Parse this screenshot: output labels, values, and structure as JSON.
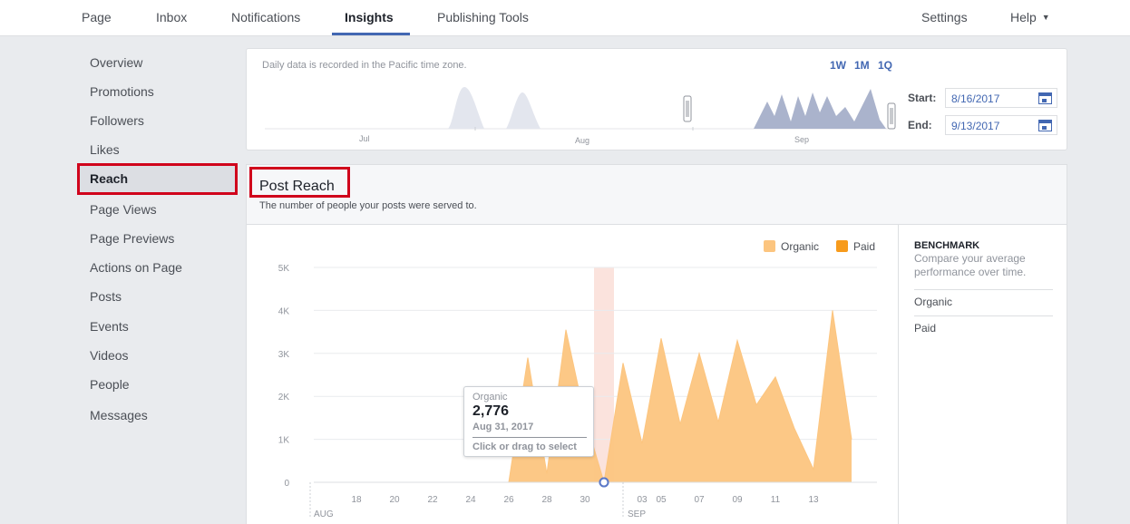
{
  "nav": {
    "items": [
      "Page",
      "Inbox",
      "Notifications",
      "Insights",
      "Publishing Tools"
    ],
    "active": "Insights",
    "right_items": [
      "Settings",
      "Help"
    ]
  },
  "sidebar": {
    "items": [
      "Overview",
      "Promotions",
      "Followers",
      "Likes",
      "Reach",
      "Page Views",
      "Page Previews",
      "Actions on Page",
      "Posts",
      "Events",
      "Videos",
      "People",
      "Messages"
    ],
    "active": "Reach"
  },
  "date_panel": {
    "timezone_note": "Daily data is recorded in the Pacific time zone.",
    "range_buttons": [
      "1W",
      "1M",
      "1Q"
    ],
    "timeline_months": [
      "Jul",
      "Aug",
      "Sep"
    ],
    "start_label": "Start:",
    "start_value": "8/16/2017",
    "end_label": "End:",
    "end_value": "9/13/2017"
  },
  "post_reach": {
    "title": "Post Reach",
    "subtitle": "The number of people your posts were served to."
  },
  "benchmark": {
    "title": "BENCHMARK",
    "description": "Compare your average performance over time.",
    "rows": [
      "Organic",
      "Paid"
    ]
  },
  "tooltip": {
    "series": "Organic",
    "value": "2,776",
    "date": "Aug 31, 2017",
    "action": "Click or drag to select"
  },
  "colors": {
    "organic": "#fcc57f",
    "paid": "#f79b1c",
    "accent": "#4267b2",
    "highlight": "#d0021b",
    "selection": "#f9d7cf"
  },
  "chart_data": {
    "type": "area",
    "x": [
      "2017-08-16",
      "2017-08-17",
      "2017-08-18",
      "2017-08-19",
      "2017-08-20",
      "2017-08-21",
      "2017-08-22",
      "2017-08-23",
      "2017-08-24",
      "2017-08-25",
      "2017-08-26",
      "2017-08-27",
      "2017-08-28",
      "2017-08-29",
      "2017-08-30",
      "2017-08-31",
      "2017-09-01",
      "2017-09-02",
      "2017-09-03",
      "2017-09-04",
      "2017-09-05",
      "2017-09-06",
      "2017-09-07",
      "2017-09-08",
      "2017-09-09",
      "2017-09-10",
      "2017-09-11",
      "2017-09-12",
      "2017-09-13"
    ],
    "x_tick_labels": [
      "18",
      "20",
      "22",
      "24",
      "26",
      "28",
      "30",
      "03",
      "05",
      "07",
      "09",
      "11",
      "13"
    ],
    "month_labels": [
      "AUG",
      "SEP"
    ],
    "series": [
      {
        "name": "Organic",
        "values": [
          0,
          0,
          0,
          0,
          0,
          0,
          0,
          0,
          0,
          0,
          0,
          2900,
          200,
          3550,
          1500,
          0,
          2776,
          900,
          3350,
          1350,
          3000,
          1400,
          3300,
          1800,
          2450,
          1250,
          300,
          4000,
          1000
        ]
      },
      {
        "name": "Paid",
        "values": [
          0,
          0,
          0,
          0,
          0,
          0,
          0,
          0,
          0,
          0,
          0,
          0,
          0,
          0,
          0,
          0,
          0,
          0,
          0,
          0,
          0,
          0,
          0,
          0,
          0,
          0,
          0,
          0,
          0
        ]
      }
    ],
    "y_ticks": [
      "0",
      "1K",
      "2K",
      "3K",
      "4K",
      "5K"
    ],
    "ylim": [
      0,
      5000
    ],
    "legend": [
      "Organic",
      "Paid"
    ],
    "legend_position": "top-right",
    "selected_date": "2017-08-31"
  }
}
